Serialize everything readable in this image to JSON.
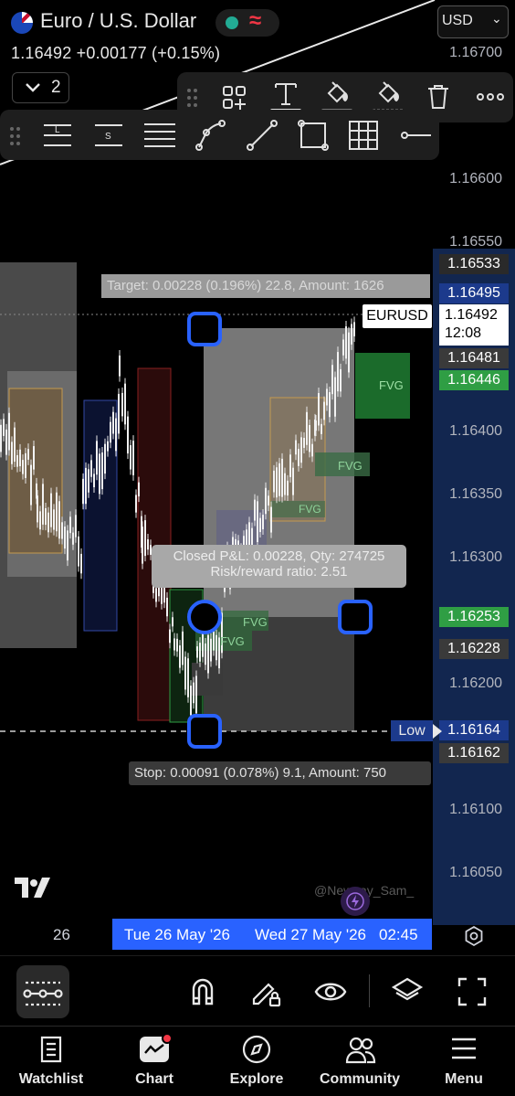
{
  "header": {
    "symbol_title": "Euro / U.S. Dollar",
    "last_price_line": "1.16492  +0.00177 (+0.15%)",
    "status_icon": "delay-wave-icon",
    "currency_select": "USD",
    "interval_count": "2"
  },
  "toolbar_top": {
    "icons": [
      "drag-handle-icon",
      "add-object-icon",
      "text-icon",
      "fill-color-icon",
      "background-color-icon",
      "trash-icon",
      "more-icon"
    ],
    "text_underline_color": "#e0e0e0",
    "fill_underline_color": "#777777"
  },
  "toolbar_bottom": {
    "icons": [
      "drag-handle-icon",
      "long-position-icon",
      "short-position-icon",
      "lines-icon",
      "path-icon",
      "trend-line-icon",
      "rectangle-icon",
      "grid-icon",
      "horizontal-ray-icon"
    ]
  },
  "price_axis": {
    "labels": [
      "1.16700",
      "1.16600",
      "1.16550",
      "1.16400",
      "1.16350",
      "1.16300",
      "1.16200",
      "1.16100",
      "1.16050"
    ],
    "badges": [
      {
        "text": "1.16533",
        "color": "#2a2a2a"
      },
      {
        "text": "1.16495",
        "color": "#1c3a8c"
      },
      {
        "text": "1.16481",
        "color": "#3a3a3a"
      },
      {
        "text": "1.16446",
        "color": "#2f9e44"
      },
      {
        "text": "1.16253",
        "color": "#2f9e44"
      },
      {
        "text": "1.16228",
        "color": "#3a3a3a"
      },
      {
        "text": "1.16164",
        "color": "#1c3a8c"
      },
      {
        "text": "1.16162",
        "color": "#3a3a3a"
      }
    ],
    "current_price": "1.16492",
    "countdown": "12:08"
  },
  "chart": {
    "target_label": "Target: 0.00228 (0.196%) 22.8, Amount: 1626",
    "symbol_tag": "EURUSD",
    "fvg_labels": [
      "FVG",
      "FVG",
      "FVG",
      "FVG",
      "FVG"
    ],
    "pnl_line1": "Closed P&L: 0.00228, Qty: 274725",
    "pnl_line2": "Risk/reward ratio: 2.51",
    "low_label": "Low",
    "stop_label": "Stop: 0.00091 (0.078%) 9.1, Amount: 750",
    "watermark": "@New_ay_Sam_"
  },
  "time_axis": {
    "left_label": "26",
    "range_start": "Tue 26 May '26",
    "range_end": "Wed 27 May '26",
    "range_time": "02:45"
  },
  "bottom_tools": [
    "drawing-tools-icon",
    "magnet-icon",
    "lock-pencil-icon",
    "eye-icon",
    "layers-icon",
    "fullscreen-icon"
  ],
  "nav": {
    "items": [
      {
        "label": "Watchlist",
        "icon": "watchlist-icon"
      },
      {
        "label": "Chart",
        "icon": "chart-icon"
      },
      {
        "label": "Explore",
        "icon": "compass-icon"
      },
      {
        "label": "Community",
        "icon": "community-icon"
      },
      {
        "label": "Menu",
        "icon": "menu-icon"
      }
    ]
  },
  "colors": {
    "accent_blue": "#2962ff",
    "handle_blue": "#2962ff",
    "up_green": "#2f9e44",
    "down_red": "#f23645"
  }
}
